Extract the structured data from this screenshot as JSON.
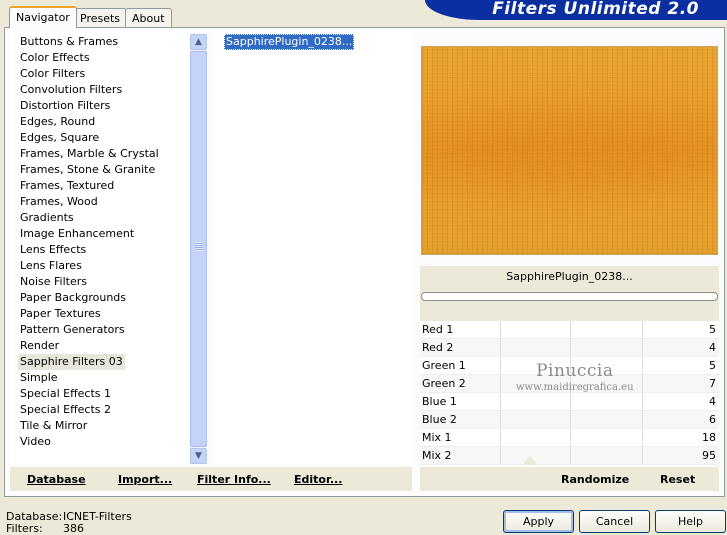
{
  "app": {
    "title": "Filters Unlimited 2.0"
  },
  "tabs": [
    {
      "label": "Navigator",
      "active": true
    },
    {
      "label": "Presets",
      "active": false
    },
    {
      "label": "About",
      "active": false
    }
  ],
  "categories": [
    "Buttons & Frames",
    "Color Effects",
    "Color Filters",
    "Convolution Filters",
    "Distortion Filters",
    "Edges, Round",
    "Edges, Square",
    "Frames, Marble & Crystal",
    "Frames, Stone & Granite",
    "Frames, Textured",
    "Frames, Wood",
    "Gradients",
    "Image Enhancement",
    "Lens Effects",
    "Lens Flares",
    "Noise Filters",
    "Paper Backgrounds",
    "Paper Textures",
    "Pattern Generators",
    "Render",
    "Sapphire Filters 03",
    "Simple",
    "Special Effects 1",
    "Special Effects 2",
    "Tile & Mirror",
    "Video"
  ],
  "selected_category": "Sapphire Filters 03",
  "filters": {
    "selected": "SapphirePlugin_0238..."
  },
  "preview": {
    "plugin_name": "SapphirePlugin_0238..."
  },
  "sliders": [
    {
      "name": "Red 1",
      "value": 5
    },
    {
      "name": "Red 2",
      "value": 4
    },
    {
      "name": "Green 1",
      "value": 5
    },
    {
      "name": "Green 2",
      "value": 7
    },
    {
      "name": "Blue 1",
      "value": 4
    },
    {
      "name": "Blue 2",
      "value": 6
    },
    {
      "name": "Mix 1",
      "value": 18
    },
    {
      "name": "Mix 2",
      "value": 95
    }
  ],
  "toolbar": {
    "database": "Database",
    "import": "Import...",
    "filter_info": "Filter Info...",
    "editor": "Editor...",
    "randomize": "Randomize",
    "reset": "Reset"
  },
  "status": {
    "database_label": "Database:",
    "database_value": "ICNET-Filters",
    "filters_label": "Filters:",
    "filters_value": "386"
  },
  "buttons": {
    "apply": "Apply",
    "cancel": "Cancel",
    "help": "Help"
  },
  "watermark": {
    "name": "Pinuccia",
    "site": "www.maidiregrafica.eu"
  },
  "colors": {
    "accent": "#0b2fa0",
    "selection": "#316ac5",
    "tab_highlight": "#f1a42c"
  }
}
